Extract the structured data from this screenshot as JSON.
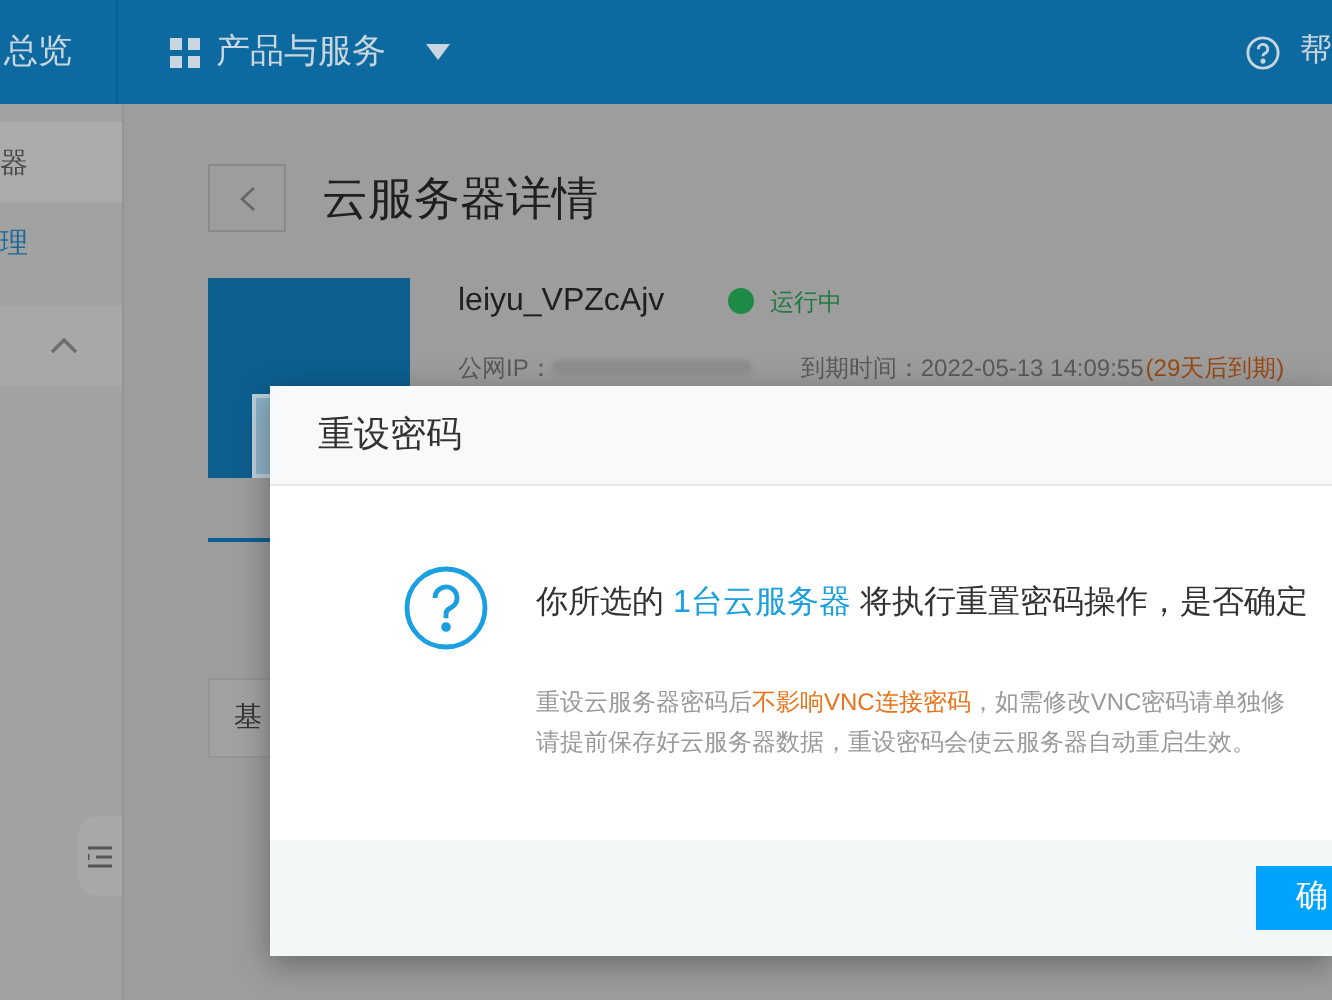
{
  "topbar": {
    "items": [
      {
        "label": "总览",
        "kind": "text"
      },
      {
        "label": "产品与服务",
        "kind": "menu"
      }
    ],
    "help": "帮"
  },
  "sidebar": {
    "items": [
      {
        "label": "器",
        "selected": false
      },
      {
        "label": "理",
        "selected": true
      }
    ]
  },
  "page": {
    "title": "云服务器详情",
    "server_name": "leiyu_VPZcAjv",
    "status": "运行中",
    "ip_label": "公网IP：",
    "expiry_label": "到期时间：",
    "expiry": "2022-05-13 14:09:55",
    "expiry_note": "(29天后到期)",
    "table_cell": "基"
  },
  "dialog": {
    "title": "重设密码",
    "message": [
      {
        "text": "你所选的 ",
        "kind": "plain"
      },
      {
        "text": "1台云服务器",
        "kind": "link"
      },
      {
        "text": " 将执行重置密码操作，是否确定",
        "kind": "plain"
      }
    ],
    "note_lines": [
      [
        {
          "text": "重设云服务器密码后",
          "kind": "plain"
        },
        {
          "text": "不影响VNC连接密码",
          "kind": "warning"
        },
        {
          "text": "，如需修改VNC密码请单独修",
          "kind": "plain"
        }
      ],
      [
        {
          "text": "请提前保存好云服务器数据，重设密码会使云服务器自动重启生效。",
          "kind": "plain"
        }
      ]
    ],
    "confirm": "确"
  }
}
